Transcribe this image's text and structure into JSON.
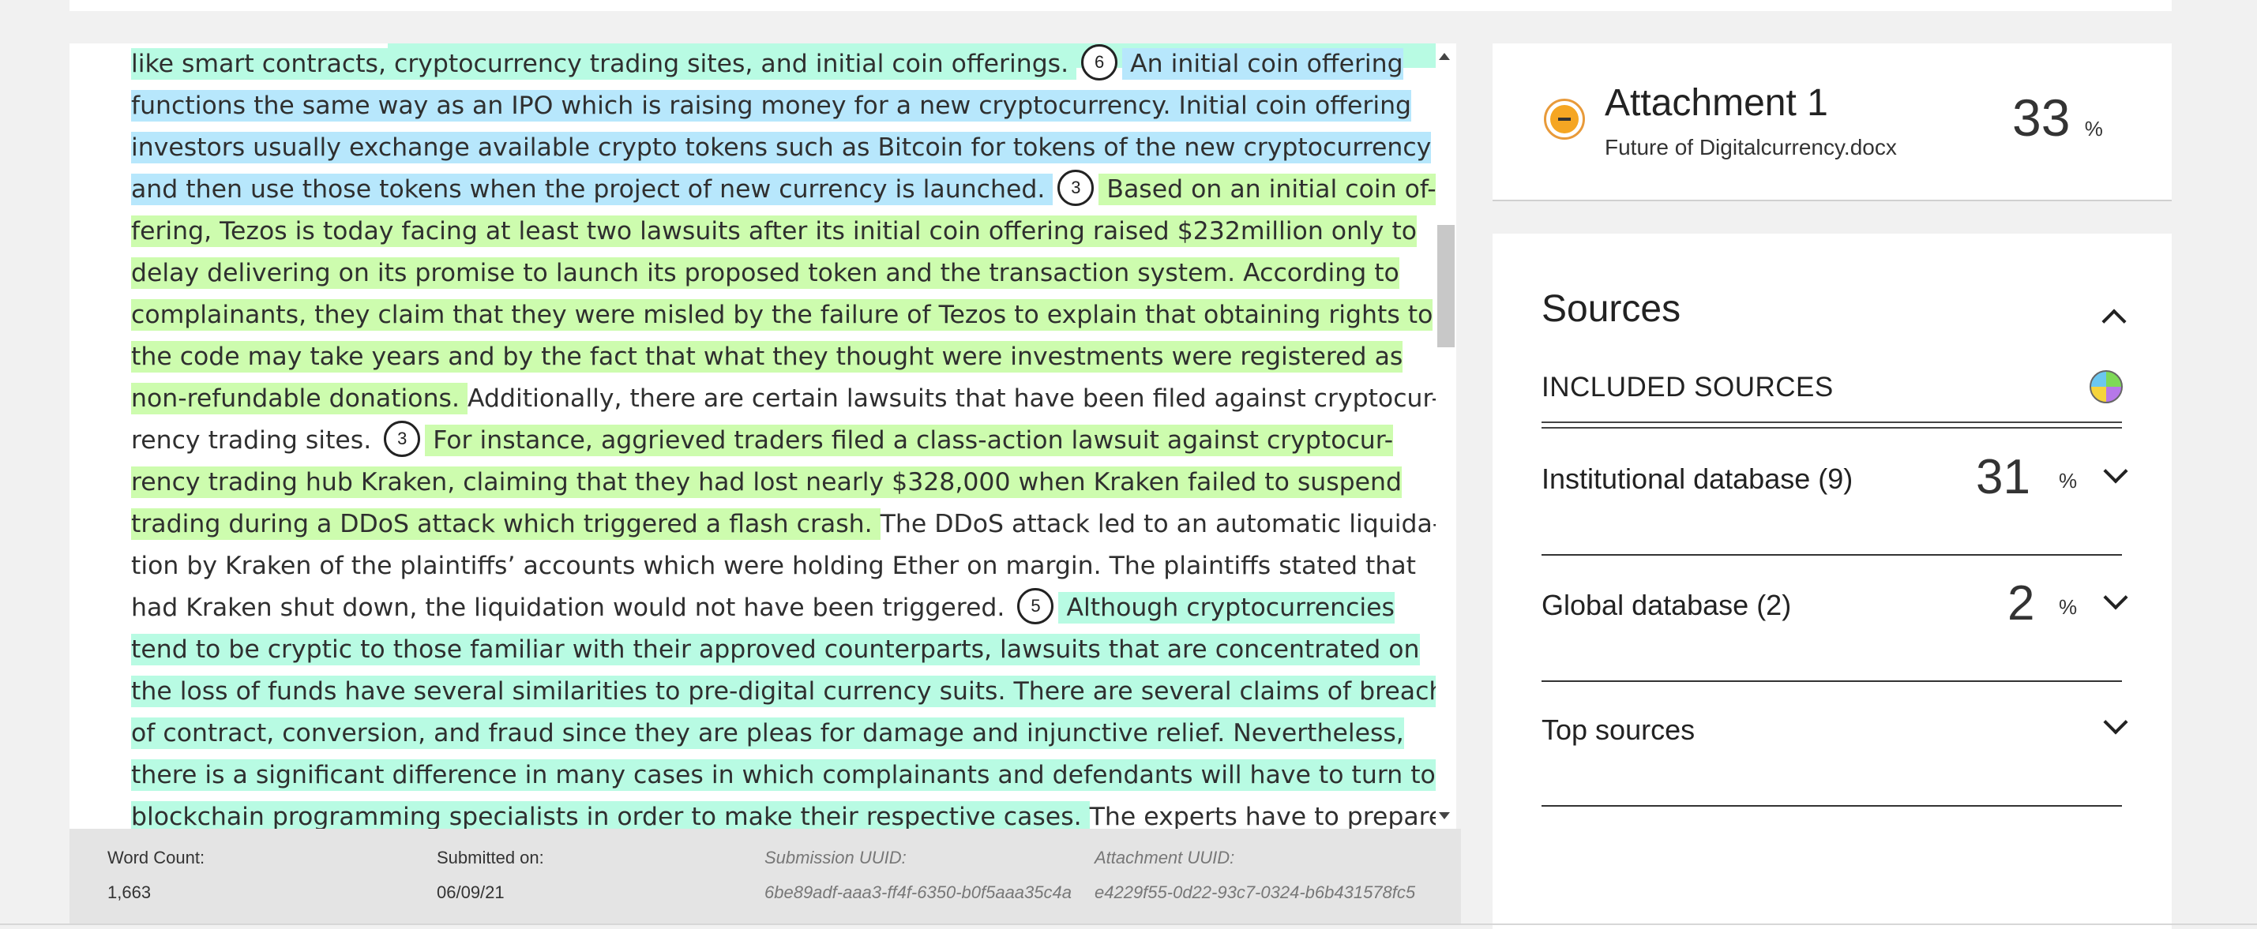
{
  "document": {
    "lines": [
      [
        {
          "t": "like smart contracts, cryptocurrency trading sites, and initial coin offerings. ",
          "c": "teal"
        },
        {
          "m": "6"
        },
        {
          "t": " An initial coin offering",
          "c": "blue"
        }
      ],
      [
        {
          "t": "functions the same way as an IPO which is raising money for a new cryptocurrency. Initial coin offering",
          "c": "blue"
        }
      ],
      [
        {
          "t": "investors usually exchange available crypto tokens such as Bitcoin for tokens of the new cryptocurrency",
          "c": "blue"
        }
      ],
      [
        {
          "t": "and then use those tokens when the project of new currency is launched. ",
          "c": "blue"
        },
        {
          "m": "3"
        },
        {
          "t": "  Based on an initial coin of-",
          "c": "green"
        }
      ],
      [
        {
          "t": "fering, Tezos is today facing at least two lawsuits after its initial coin offering raised $232million only to",
          "c": "green"
        }
      ],
      [
        {
          "t": "delay delivering on its promise to launch its proposed token and the transaction system. According to",
          "c": "green"
        }
      ],
      [
        {
          "t": "complainants, they claim that they were misled by the failure of Tezos to explain that obtaining rights to",
          "c": "green"
        }
      ],
      [
        {
          "t": "the code may take years and by the fact that what they thought were investments were registered as",
          "c": "green"
        }
      ],
      [
        {
          "t": "non-refundable donations. ",
          "c": "green"
        },
        {
          "t": "Additionally, there are certain lawsuits that have been filed against cryptocur-"
        }
      ],
      [
        {
          "t": "rency trading sites. "
        },
        {
          "m": "3"
        },
        {
          "t": "  For instance, aggrieved traders filed a class-action lawsuit against cryptocur-",
          "c": "green"
        }
      ],
      [
        {
          "t": "rency trading hub Kraken, claiming that they had lost nearly $328,000 when Kraken failed to suspend",
          "c": "green"
        }
      ],
      [
        {
          "t": "trading during a DDoS attack which triggered a flash crash. ",
          "c": "green"
        },
        {
          "t": "The DDoS attack led to an automatic liquida-"
        }
      ],
      [
        {
          "t": "tion by Kraken of the plaintiffs’ accounts which were holding Ether on margin. The plaintiffs stated that"
        }
      ],
      [
        {
          "t": "had Kraken shut down, the liquidation would not have been triggered. "
        },
        {
          "m": "5"
        },
        {
          "t": "  Although cryptocurrencies",
          "c": "teal"
        }
      ],
      [
        {
          "t": "tend to be cryptic to those familiar with their approved counterparts, lawsuits that are concentrated on",
          "c": "teal"
        }
      ],
      [
        {
          "t": "the loss of funds have several similarities to pre-digital currency suits. There are several claims of breach",
          "c": "teal"
        }
      ],
      [
        {
          "t": "of contract, conversion, and fraud since they are pleas for damage and injunctive relief. Nevertheless,",
          "c": "teal"
        }
      ],
      [
        {
          "t": "there is a significant difference in many cases in which complainants and defendants will have to turn to",
          "c": "teal"
        }
      ],
      [
        {
          "t": "blockchain programming specialists in order to make their respective cases. ",
          "c": "teal"
        },
        {
          "t": "The experts have to prepare"
        }
      ]
    ]
  },
  "footer": {
    "word_count_label": "Word Count:",
    "word_count": "1,663",
    "submitted_label": "Submitted on:",
    "submitted": "06/09/21",
    "submission_uuid_label": "Submission UUID:",
    "submission_uuid": "6be89adf-aaa3-ff4f-6350-b0f5aaa35c4a",
    "attachment_uuid_label": "Attachment UUID:",
    "attachment_uuid": "e4229f55-0d22-93c7-0324-b6b431578fc5"
  },
  "attachment": {
    "title": "Attachment 1",
    "filename": "Future of Digitalcurrency.docx",
    "percent": "33",
    "percent_sign": "%"
  },
  "sources": {
    "title": "Sources",
    "included_label": "INCLUDED SOURCES",
    "rows": [
      {
        "label": "Institutional database (9)",
        "percent": "31",
        "sign": "%"
      },
      {
        "label": "Global database (2)",
        "percent": "2",
        "sign": "%"
      },
      {
        "label": "Top sources"
      }
    ]
  }
}
